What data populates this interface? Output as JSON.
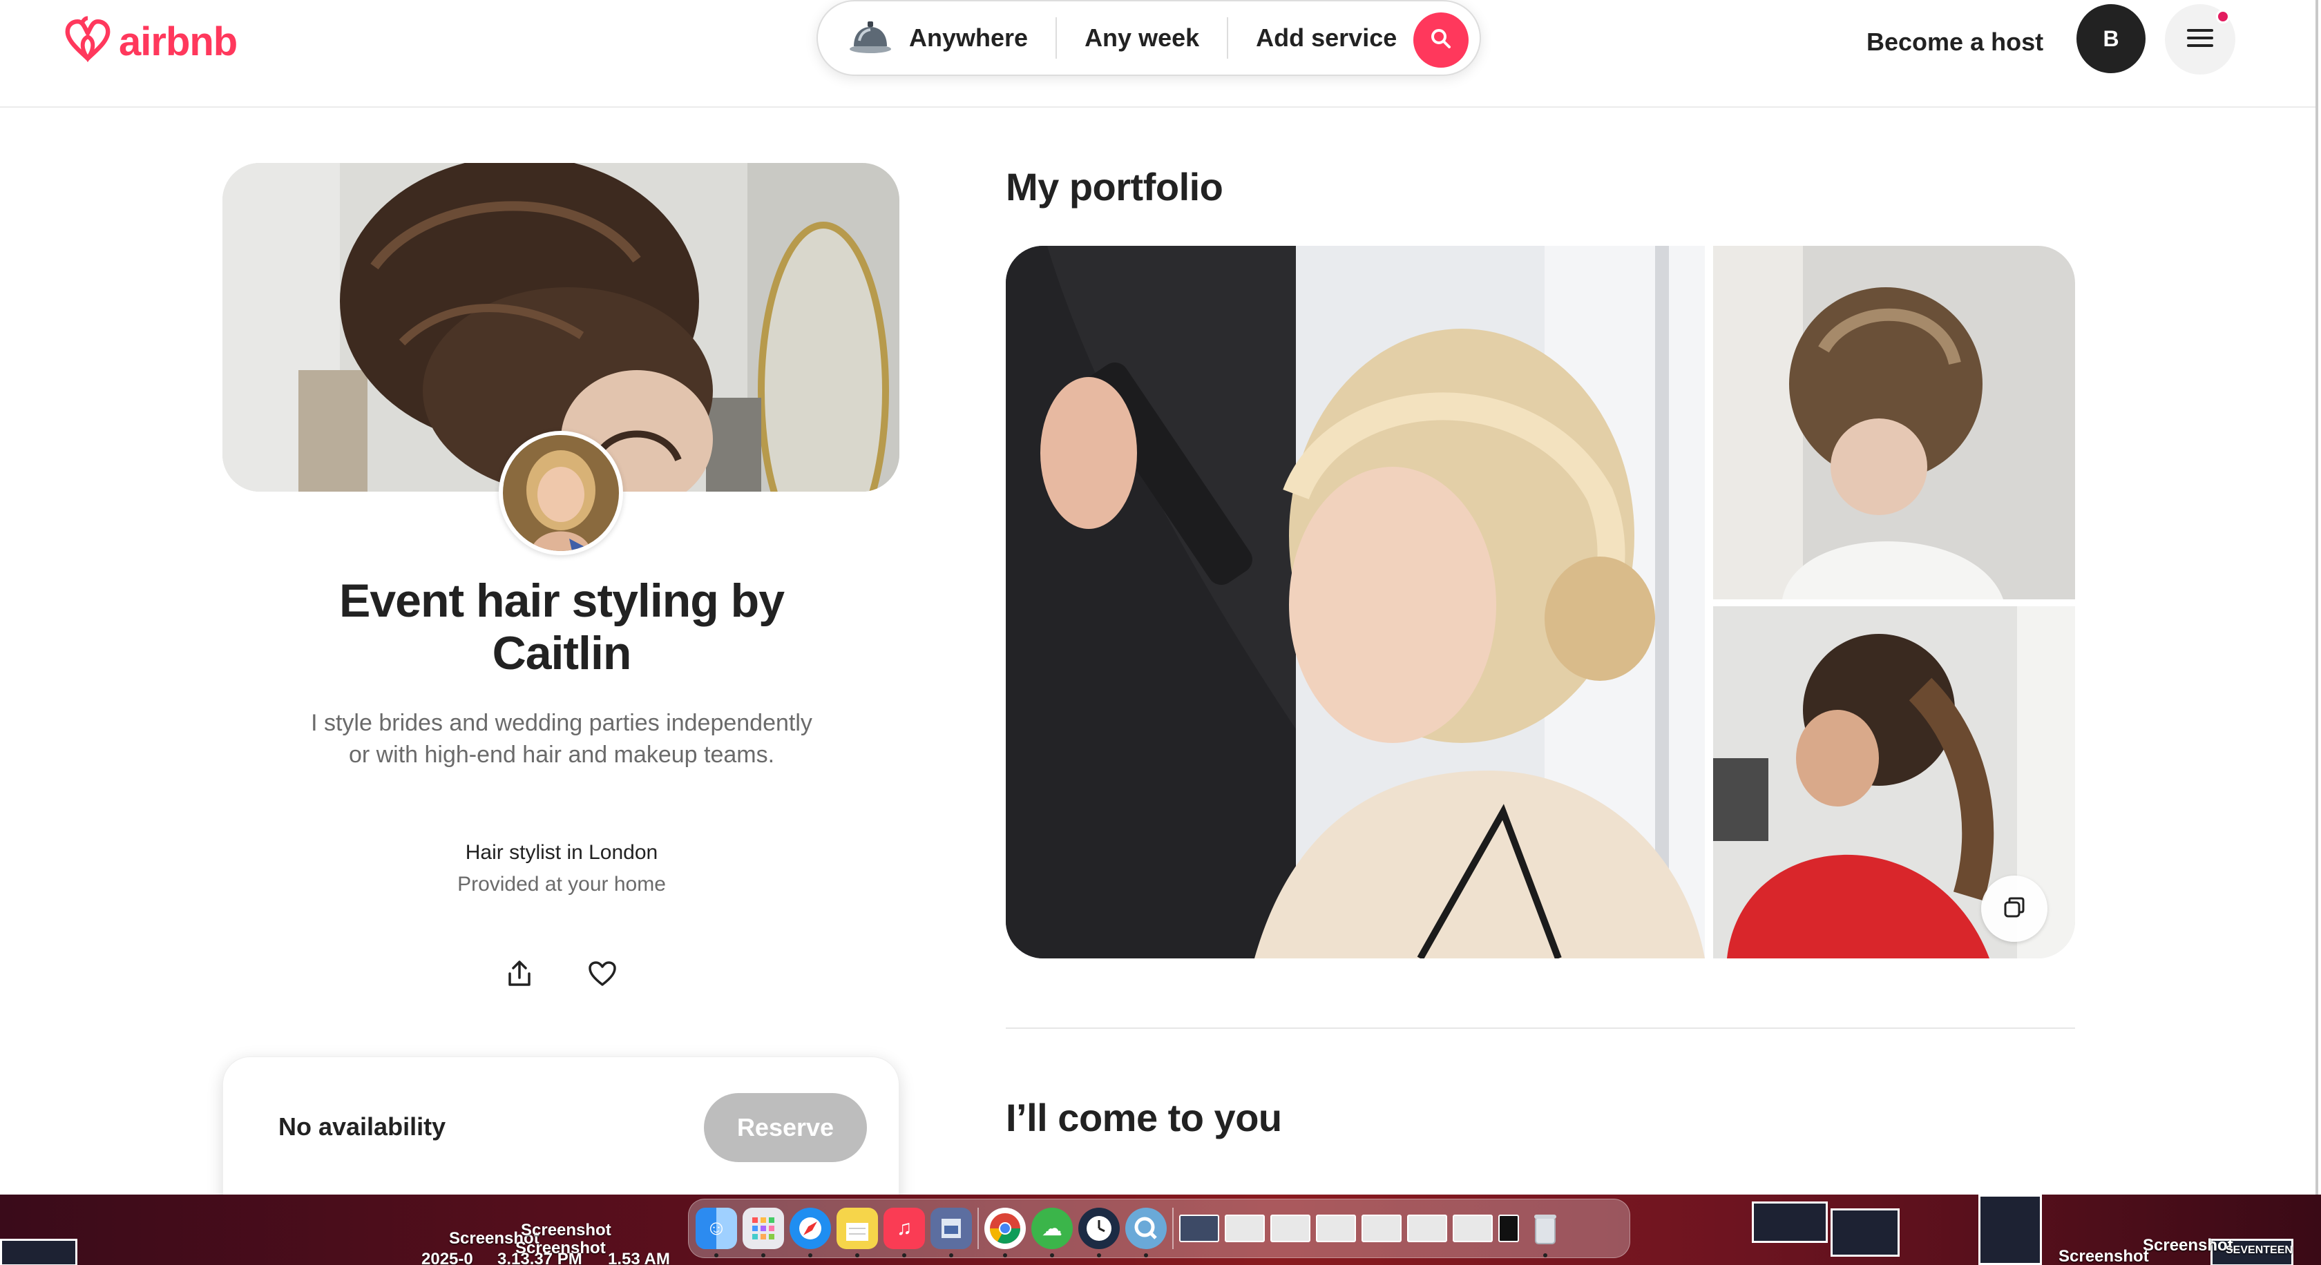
{
  "header": {
    "logo_text": "airbnb",
    "search": {
      "location": "Anywhere",
      "dates": "Any week",
      "service": "Add service"
    },
    "become_host": "Become a host",
    "avatar_initial": "B",
    "colors": {
      "brand": "#ff385c",
      "notification": "#e31c5f"
    }
  },
  "profile": {
    "title": "Event hair styling by Caitlin",
    "tagline": "I style brides and wedding parties independently or with high-end hair and makeup teams.",
    "role": "Hair stylist in London",
    "location": "Provided at your home"
  },
  "booking": {
    "availability": "No availability",
    "reserve_label": "Reserve"
  },
  "portfolio": {
    "title": "My portfolio"
  },
  "travel": {
    "title": "I’ll come to you"
  },
  "desktop": {
    "labels": [
      "Screenshot",
      "Screenshot",
      "Screenshot",
      "Screenshot",
      "Screenshot"
    ],
    "date_label": "2025-0",
    "time_labels": [
      "3.13.37 PM",
      "1.53 AM"
    ],
    "right_label": "SEVENTEEN"
  },
  "icons": [
    "airbnb-logo-icon",
    "concierge-bell-icon",
    "search-icon",
    "menu-icon",
    "share-icon",
    "heart-icon",
    "gallery-icon"
  ]
}
